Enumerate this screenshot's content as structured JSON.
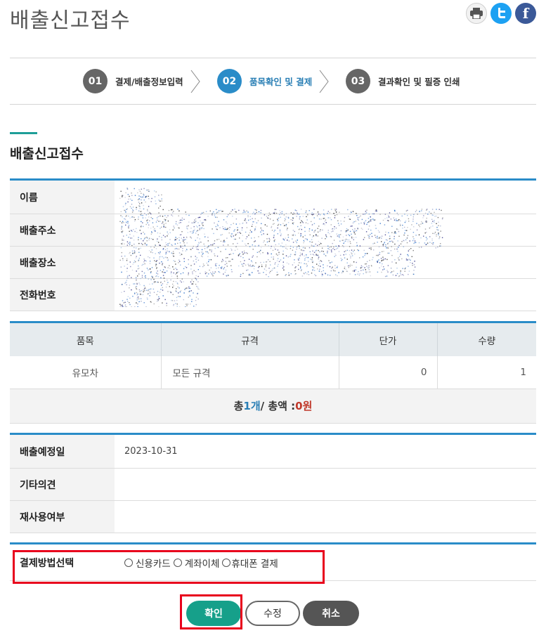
{
  "page": {
    "title": "배출신고접수"
  },
  "share": {
    "print_icon": "print-icon",
    "twitter_icon": "twitter-icon",
    "facebook_icon": "facebook-icon"
  },
  "steps": [
    {
      "num": "01",
      "label": "결제/배출정보입력",
      "active": false
    },
    {
      "num": "02",
      "label": "품목확인 및 결제",
      "active": true
    },
    {
      "num": "03",
      "label": "결과확인 및 필증 인쇄",
      "active": false
    }
  ],
  "section": {
    "title": "배출신고접수"
  },
  "applicant": {
    "name_label": "이름",
    "address_label": "배출주소",
    "place_label": "배출장소",
    "phone_label": "전화번호"
  },
  "goods": {
    "headers": [
      "품목",
      "규격",
      "단가",
      "수량"
    ],
    "rows": [
      {
        "item": "유모차",
        "spec": "모든 규격",
        "price": "0",
        "qty": "1"
      }
    ],
    "total": {
      "prefix": "총 ",
      "count": "1개",
      "sep": " / 총액 : ",
      "amount": "0원"
    }
  },
  "extra": {
    "date_label": "배출예정일",
    "date_value": "2023-10-31",
    "memo_label": "기타의견",
    "reuse_label": "재사용여부"
  },
  "payment": {
    "label": "결제방법선택",
    "options": [
      "신용카드",
      "계좌이체",
      "휴대폰 결제"
    ]
  },
  "buttons": {
    "ok": "확인",
    "edit": "수정",
    "cancel": "취소"
  },
  "colors": {
    "accent": "#2a8cc8",
    "primary_button": "#16a08a",
    "highlight": "#e8001c"
  }
}
